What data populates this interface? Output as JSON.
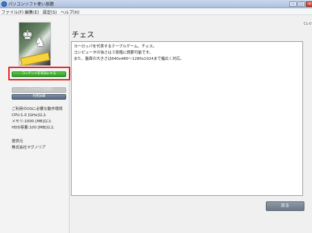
{
  "window": {
    "title": "パソコンソフト使い放題",
    "buttons": [
      "−",
      "□",
      "×"
    ]
  },
  "menu": [
    {
      "label": "ファイル(F)"
    },
    {
      "label": "編集(E)"
    },
    {
      "label": "設定(S)"
    },
    {
      "label": "ヘルプ(H)"
    }
  ],
  "sidebar": {
    "enable_label": "コンテンツを有効にする",
    "disabled_label": "ソフトウェアを実行",
    "details_label": "利用詳細",
    "requirements": [
      "ご利用のOSに必要な動作環境",
      "CPU:1.0 [GHz]以上",
      "メモリ:1000 [MB]以上",
      "HDD容量:100 [MB]以上"
    ],
    "provider_heading": "提供元",
    "provider_name": "株式会社マグノリア"
  },
  "main": {
    "title": "チェス",
    "code": "CL-0",
    "description": [
      "ヨーロッパを代表するテーブルゲーム、チェス。",
      "コンピュータの強さは３段階に調節可能です。",
      "また、盤面の大きさは640x480～1280x1024まで幅広く対応。"
    ],
    "back_label": "戻る"
  },
  "colors": {
    "enable_button": "#2c9a1f",
    "highlight": "#e61b1b",
    "details_button": "#56677d"
  }
}
